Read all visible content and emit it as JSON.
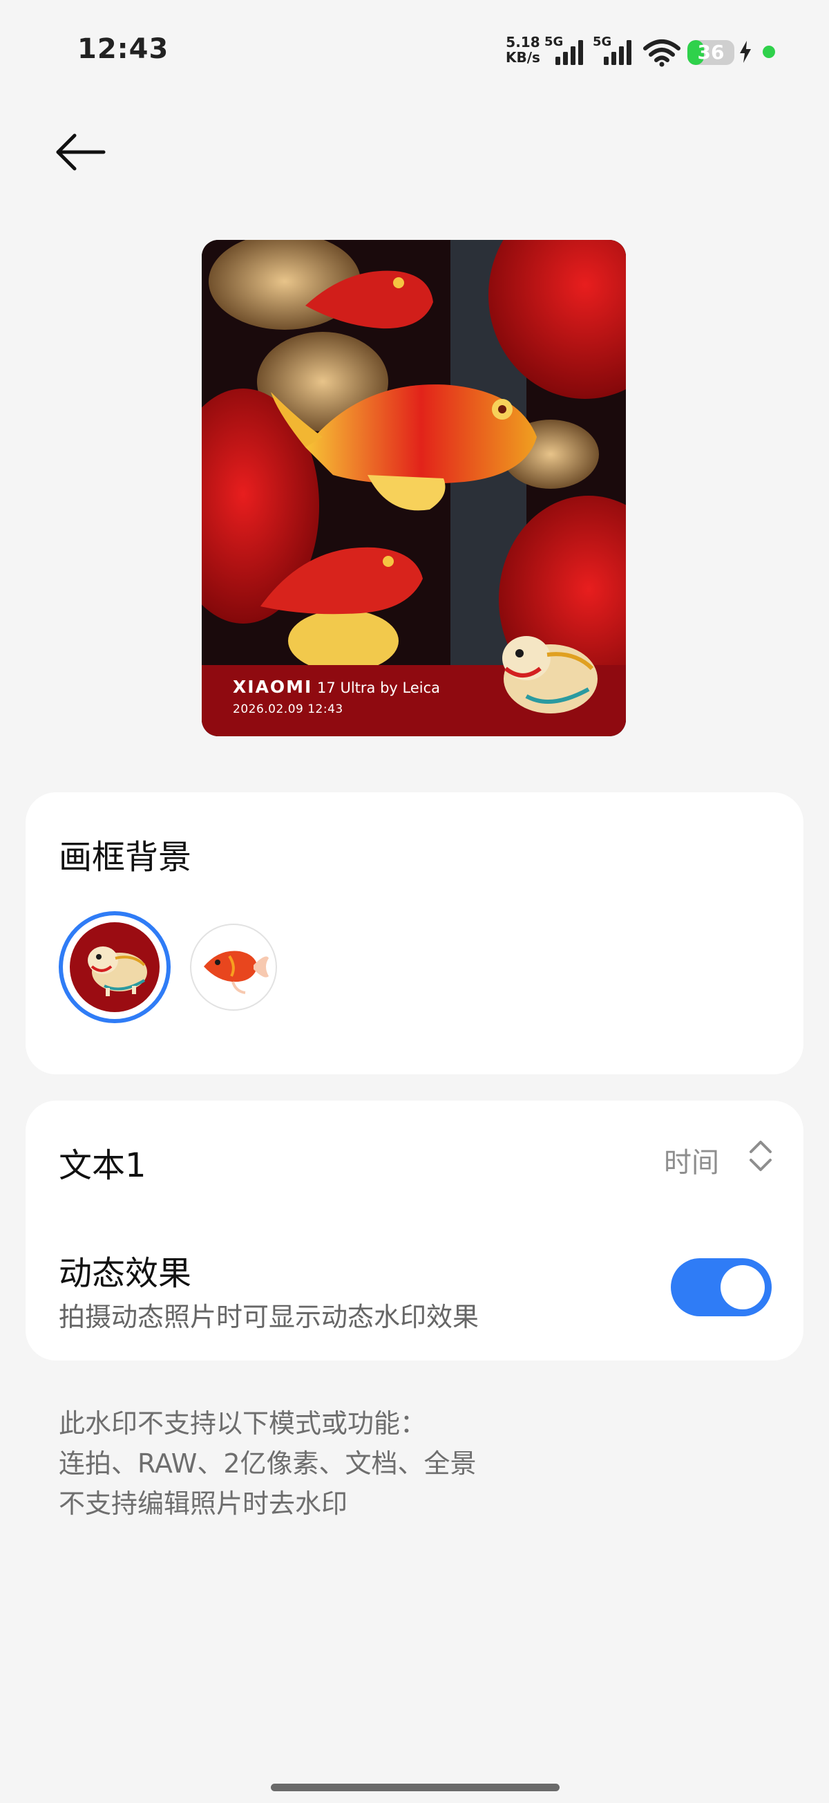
{
  "status_bar": {
    "time": "12:43",
    "net_speed_value": "5.18",
    "net_speed_unit": "KB/s",
    "sim1_label": "5G",
    "sim2_label": "5G",
    "battery_level": "36",
    "battery_fraction": 0.36,
    "battery_color": "#2fd14b"
  },
  "header": {
    "back_icon": "arrow-left-icon"
  },
  "preview": {
    "watermark_brand": "XIAOMI",
    "watermark_model": "17 Ultra",
    "watermark_by": "by Leica",
    "watermark_datetime": "2026.02.09 12:43"
  },
  "frame_background": {
    "title": "画框背景",
    "options": [
      {
        "icon": "lion-dance-icon",
        "selected": true
      },
      {
        "icon": "goldfish-icon",
        "selected": false
      }
    ],
    "accent_color": "#2f7cf6"
  },
  "settings": {
    "text1_label": "文本1",
    "text1_value": "时间",
    "dynamic_label": "动态效果",
    "dynamic_desc": "拍摄动态照片时可显示动态水印效果",
    "dynamic_enabled": true
  },
  "notes": {
    "line1": "此水印不支持以下模式或功能：",
    "line2": "连拍、RAW、2亿像素、文档、全景",
    "line3": "不支持编辑照片时去水印"
  }
}
